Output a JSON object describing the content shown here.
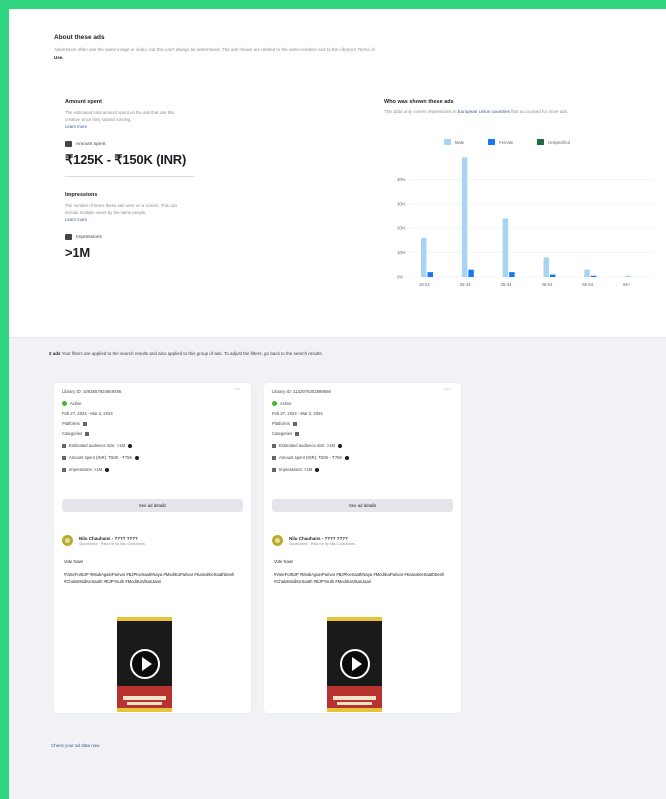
{
  "about": {
    "title": "About these ads",
    "desc_prefix": "Advertisers often use the same image or video, but this can't always be determined. The ads shown are related to the same creative and to the Library's Terms of",
    "desc_link": "Use."
  },
  "amount_spent": {
    "title": "Amount spent",
    "desc": "The estimated total amount spent on the ads that use this creative since they started running.",
    "learn_more": "Learn more",
    "label": "Amount spent",
    "value": "₹125K - ₹150K (INR)"
  },
  "impressions": {
    "title": "Impressions",
    "desc": "The number of times these ads were on a screen. This can include multiple views by the same people.",
    "learn_more": "Learn more",
    "label": "Impressions",
    "value": ">1M"
  },
  "audience": {
    "title": "Who was shown these ads",
    "desc_prefix": "This data only covers impressions in",
    "desc_link": "European Union countries",
    "desc_suffix": "that accounted for more ads.",
    "colors": {
      "male": "#a9d3f3",
      "female": "#1877f2",
      "unknown": "#1f6b43"
    }
  },
  "chart_data": {
    "type": "bar",
    "categories": [
      "18-24",
      "25-34",
      "35-44",
      "45-54",
      "55-64",
      "65+"
    ],
    "series": [
      {
        "name": "Male",
        "values": [
          16,
          49,
          24,
          8,
          3,
          0.5
        ]
      },
      {
        "name": "Female",
        "values": [
          2,
          3,
          2,
          1,
          0.5,
          0
        ]
      },
      {
        "name": "Unspecified",
        "values": [
          0,
          0,
          0,
          0,
          0,
          0
        ]
      }
    ],
    "yticks": [
      "0%",
      "10%",
      "20%",
      "30%",
      "40%"
    ],
    "ylim": [
      0,
      50
    ],
    "grid": true,
    "legend_position": "top"
  },
  "results_bar": {
    "count": "2 ads",
    "text": "Your filters are applied to the search results and also applied to this group of ads. To adjust the filters, go back to the search results."
  },
  "cards": [
    {
      "library_id": "Library ID: 1063657934659495",
      "status": "Active",
      "dates": "Feb 27, 2024 - Mar 2, 2024",
      "platforms": "Platforms",
      "categories": "Categories",
      "audience_size": "Estimated audience size: >1M",
      "amount_spent": "Amount spent (INR): ₹50K - ₹75K",
      "impressions": "Impressions: >1M",
      "details_button": "See ad details",
      "advertiser": "Nilu Chauhans - ???? ????",
      "sponsored": "Sponsored · Paid for by Nilu Chauhans",
      "body_label": "Vote Now!",
      "body_text": "#VoteForBJP #ModiAgainParivar #BJPKeSaathNaya #ModiKaParivar #KamalKeSaathDesh #ChaloModiKeSaath #BJPYouth #ModiKaVikasJaari"
    },
    {
      "library_id": "Library ID: 1132976302589566",
      "status": "Active",
      "dates": "Feb 27, 2024 - Mar 2, 2024",
      "platforms": "Platforms",
      "categories": "Categories",
      "audience_size": "Estimated audience size: >1M",
      "amount_spent": "Amount spent (INR): ₹50K - ₹75K",
      "impressions": "Impressions: >1M",
      "details_button": "See ad details",
      "advertiser": "Nilu Chauhans - ???? ????",
      "sponsored": "Sponsored · Paid for by Nilu Chauhans",
      "body_label": "Vote Now!",
      "body_text": "#VoteForBJP #ModiAgainParivar #BJPKeSaathNaya #ModiKaParivar #KamalKeSaathDesh #ChaloModiKeSaath #BJPYouth #ModiKaVikasJaari"
    }
  ],
  "footer_link": "Check your ad data now",
  "icons": {
    "more": "more-horizontal-icon",
    "play": "play-icon"
  }
}
